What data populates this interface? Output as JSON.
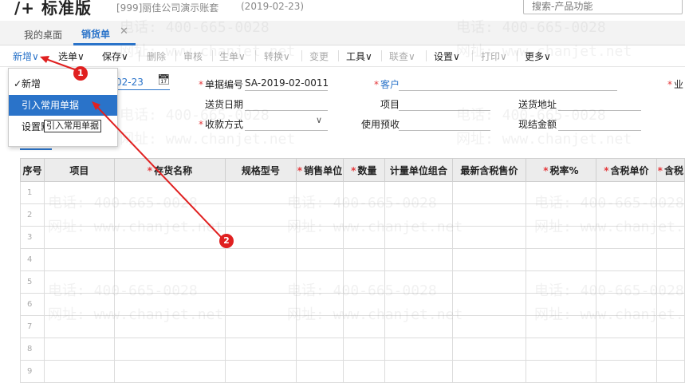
{
  "header": {
    "logo": "标准版",
    "company": "[999]丽佳公司演示账套",
    "date": "(2019-02-23)",
    "search_placeholder": "搜索-产品功能"
  },
  "tabs": [
    {
      "label": "我的桌面"
    },
    {
      "label": "销货单"
    }
  ],
  "tab_close": "✕",
  "toolbar": {
    "items": [
      "新增",
      "选单",
      "保存",
      "删除",
      "审核",
      "生单",
      "转换",
      "变更",
      "工具",
      "联查",
      "设置",
      "打印",
      "更多"
    ]
  },
  "menu": {
    "items": [
      "新增",
      "引入常用单据",
      "设置默"
    ],
    "checkmark": "✓",
    "tooltip": "引入常用单据"
  },
  "form": {
    "date_value": "02-23",
    "doc_no_label": "单据编号",
    "doc_no_value": "SA-2019-02-0011",
    "customer_label": "客户",
    "biz_label": "业",
    "delivery_date_label": "送货日期",
    "project_label": "项目",
    "delivery_addr_label": "送货地址",
    "payment_label": "收款方式",
    "prepay_label": "使用预收",
    "cash_label": "现结金额"
  },
  "grid": {
    "headers": [
      "序号",
      "项目",
      "存货名称",
      "规格型号",
      "销售单位",
      "数量",
      "计量单位组合",
      "最新含税售价",
      "税率%",
      "含税单价",
      "含税"
    ],
    "required": [
      false,
      false,
      true,
      false,
      true,
      true,
      false,
      false,
      true,
      true,
      true
    ],
    "rows": [
      "1",
      "2",
      "3",
      "4",
      "5",
      "6",
      "7",
      "8",
      "9"
    ]
  },
  "watermark": {
    "phone": "电话: 400-665-0028",
    "site": "网址: www.chanjet.net"
  },
  "annotations": [
    "1",
    "2"
  ],
  "colors": {
    "accent": "#2a73c9",
    "badge": "#e02020"
  }
}
